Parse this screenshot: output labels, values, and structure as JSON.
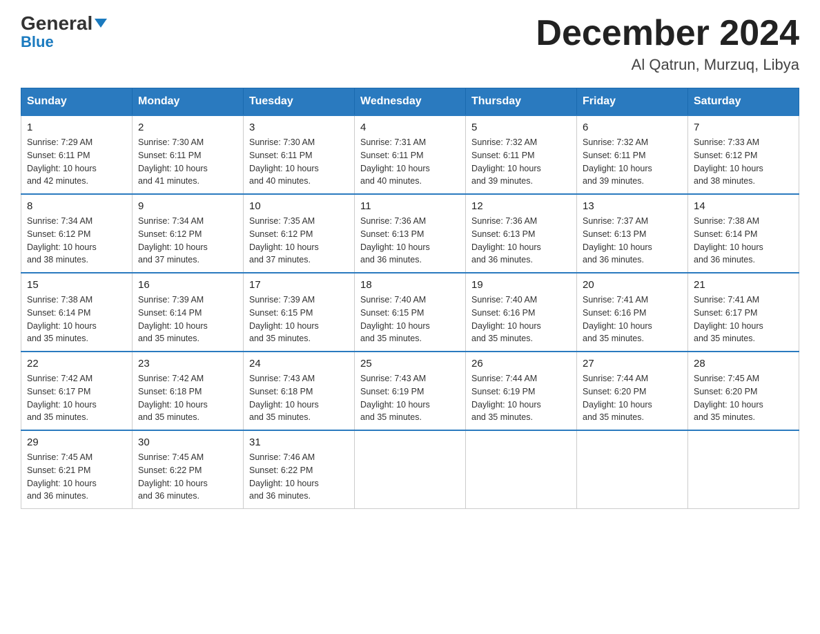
{
  "logo": {
    "general": "General",
    "triangle": "▶",
    "blue": "Blue"
  },
  "title": "December 2024",
  "subtitle": "Al Qatrun, Murzuq, Libya",
  "headers": [
    "Sunday",
    "Monday",
    "Tuesday",
    "Wednesday",
    "Thursday",
    "Friday",
    "Saturday"
  ],
  "weeks": [
    [
      {
        "day": "1",
        "sunrise": "7:29 AM",
        "sunset": "6:11 PM",
        "daylight": "10 hours and 42 minutes."
      },
      {
        "day": "2",
        "sunrise": "7:30 AM",
        "sunset": "6:11 PM",
        "daylight": "10 hours and 41 minutes."
      },
      {
        "day": "3",
        "sunrise": "7:30 AM",
        "sunset": "6:11 PM",
        "daylight": "10 hours and 40 minutes."
      },
      {
        "day": "4",
        "sunrise": "7:31 AM",
        "sunset": "6:11 PM",
        "daylight": "10 hours and 40 minutes."
      },
      {
        "day": "5",
        "sunrise": "7:32 AM",
        "sunset": "6:11 PM",
        "daylight": "10 hours and 39 minutes."
      },
      {
        "day": "6",
        "sunrise": "7:32 AM",
        "sunset": "6:11 PM",
        "daylight": "10 hours and 39 minutes."
      },
      {
        "day": "7",
        "sunrise": "7:33 AM",
        "sunset": "6:12 PM",
        "daylight": "10 hours and 38 minutes."
      }
    ],
    [
      {
        "day": "8",
        "sunrise": "7:34 AM",
        "sunset": "6:12 PM",
        "daylight": "10 hours and 38 minutes."
      },
      {
        "day": "9",
        "sunrise": "7:34 AM",
        "sunset": "6:12 PM",
        "daylight": "10 hours and 37 minutes."
      },
      {
        "day": "10",
        "sunrise": "7:35 AM",
        "sunset": "6:12 PM",
        "daylight": "10 hours and 37 minutes."
      },
      {
        "day": "11",
        "sunrise": "7:36 AM",
        "sunset": "6:13 PM",
        "daylight": "10 hours and 36 minutes."
      },
      {
        "day": "12",
        "sunrise": "7:36 AM",
        "sunset": "6:13 PM",
        "daylight": "10 hours and 36 minutes."
      },
      {
        "day": "13",
        "sunrise": "7:37 AM",
        "sunset": "6:13 PM",
        "daylight": "10 hours and 36 minutes."
      },
      {
        "day": "14",
        "sunrise": "7:38 AM",
        "sunset": "6:14 PM",
        "daylight": "10 hours and 36 minutes."
      }
    ],
    [
      {
        "day": "15",
        "sunrise": "7:38 AM",
        "sunset": "6:14 PM",
        "daylight": "10 hours and 35 minutes."
      },
      {
        "day": "16",
        "sunrise": "7:39 AM",
        "sunset": "6:14 PM",
        "daylight": "10 hours and 35 minutes."
      },
      {
        "day": "17",
        "sunrise": "7:39 AM",
        "sunset": "6:15 PM",
        "daylight": "10 hours and 35 minutes."
      },
      {
        "day": "18",
        "sunrise": "7:40 AM",
        "sunset": "6:15 PM",
        "daylight": "10 hours and 35 minutes."
      },
      {
        "day": "19",
        "sunrise": "7:40 AM",
        "sunset": "6:16 PM",
        "daylight": "10 hours and 35 minutes."
      },
      {
        "day": "20",
        "sunrise": "7:41 AM",
        "sunset": "6:16 PM",
        "daylight": "10 hours and 35 minutes."
      },
      {
        "day": "21",
        "sunrise": "7:41 AM",
        "sunset": "6:17 PM",
        "daylight": "10 hours and 35 minutes."
      }
    ],
    [
      {
        "day": "22",
        "sunrise": "7:42 AM",
        "sunset": "6:17 PM",
        "daylight": "10 hours and 35 minutes."
      },
      {
        "day": "23",
        "sunrise": "7:42 AM",
        "sunset": "6:18 PM",
        "daylight": "10 hours and 35 minutes."
      },
      {
        "day": "24",
        "sunrise": "7:43 AM",
        "sunset": "6:18 PM",
        "daylight": "10 hours and 35 minutes."
      },
      {
        "day": "25",
        "sunrise": "7:43 AM",
        "sunset": "6:19 PM",
        "daylight": "10 hours and 35 minutes."
      },
      {
        "day": "26",
        "sunrise": "7:44 AM",
        "sunset": "6:19 PM",
        "daylight": "10 hours and 35 minutes."
      },
      {
        "day": "27",
        "sunrise": "7:44 AM",
        "sunset": "6:20 PM",
        "daylight": "10 hours and 35 minutes."
      },
      {
        "day": "28",
        "sunrise": "7:45 AM",
        "sunset": "6:20 PM",
        "daylight": "10 hours and 35 minutes."
      }
    ],
    [
      {
        "day": "29",
        "sunrise": "7:45 AM",
        "sunset": "6:21 PM",
        "daylight": "10 hours and 36 minutes."
      },
      {
        "day": "30",
        "sunrise": "7:45 AM",
        "sunset": "6:22 PM",
        "daylight": "10 hours and 36 minutes."
      },
      {
        "day": "31",
        "sunrise": "7:46 AM",
        "sunset": "6:22 PM",
        "daylight": "10 hours and 36 minutes."
      },
      null,
      null,
      null,
      null
    ]
  ],
  "labels": {
    "sunrise": "Sunrise:",
    "sunset": "Sunset:",
    "daylight": "Daylight:"
  }
}
